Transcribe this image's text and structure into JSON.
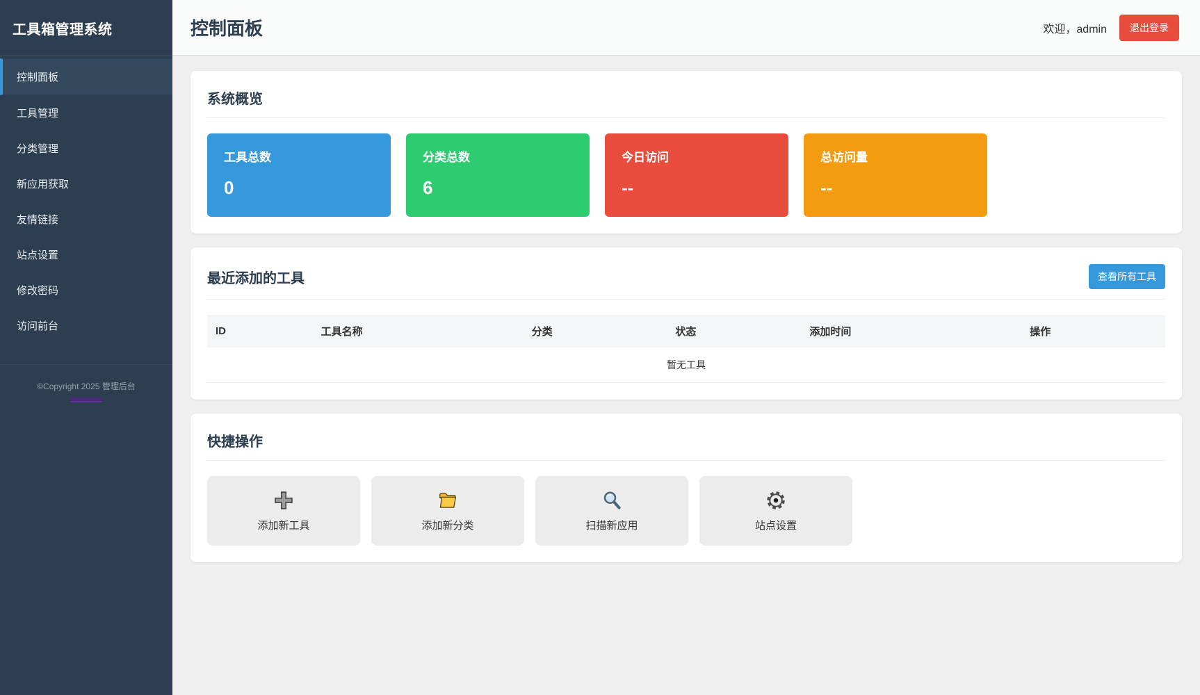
{
  "brand": {
    "title": "工具箱管理系统"
  },
  "sidebar": {
    "items": [
      {
        "label": "控制面板",
        "active": true
      },
      {
        "label": "工具管理",
        "active": false
      },
      {
        "label": "分类管理",
        "active": false
      },
      {
        "label": "新应用获取",
        "active": false
      },
      {
        "label": "友情链接",
        "active": false
      },
      {
        "label": "站点设置",
        "active": false
      },
      {
        "label": "修改密码",
        "active": false
      },
      {
        "label": "访问前台",
        "active": false
      }
    ],
    "footer": {
      "copyright": "©Copyright 2025 管理后台"
    }
  },
  "header": {
    "title": "控制面板",
    "welcome": "欢迎，admin",
    "logout_label": "退出登录"
  },
  "overview": {
    "title": "系统概览",
    "stats": [
      {
        "label": "工具总数",
        "value": "0",
        "color": "#3498db"
      },
      {
        "label": "分类总数",
        "value": "6",
        "color": "#2ecc71"
      },
      {
        "label": "今日访问",
        "value": "--",
        "color": "#e74c3c"
      },
      {
        "label": "总访问量",
        "value": "--",
        "color": "#f39c12"
      }
    ]
  },
  "recent_tools": {
    "title": "最近添加的工具",
    "view_all_label": "查看所有工具",
    "columns": [
      "ID",
      "工具名称",
      "分类",
      "状态",
      "添加时间",
      "操作"
    ],
    "empty_text": "暂无工具"
  },
  "quick_actions": {
    "title": "快捷操作",
    "actions": [
      {
        "icon": "plus-icon",
        "label": "添加新工具"
      },
      {
        "icon": "folder-icon",
        "label": "添加新分类"
      },
      {
        "icon": "search-icon",
        "label": "扫描新应用"
      },
      {
        "icon": "gear-icon",
        "label": "站点设置"
      }
    ]
  },
  "colors": {
    "sidebar_bg": "#2c3e50",
    "accent_blue": "#3498db",
    "green": "#2ecc71",
    "red": "#e74c3c",
    "orange": "#f39c12"
  }
}
